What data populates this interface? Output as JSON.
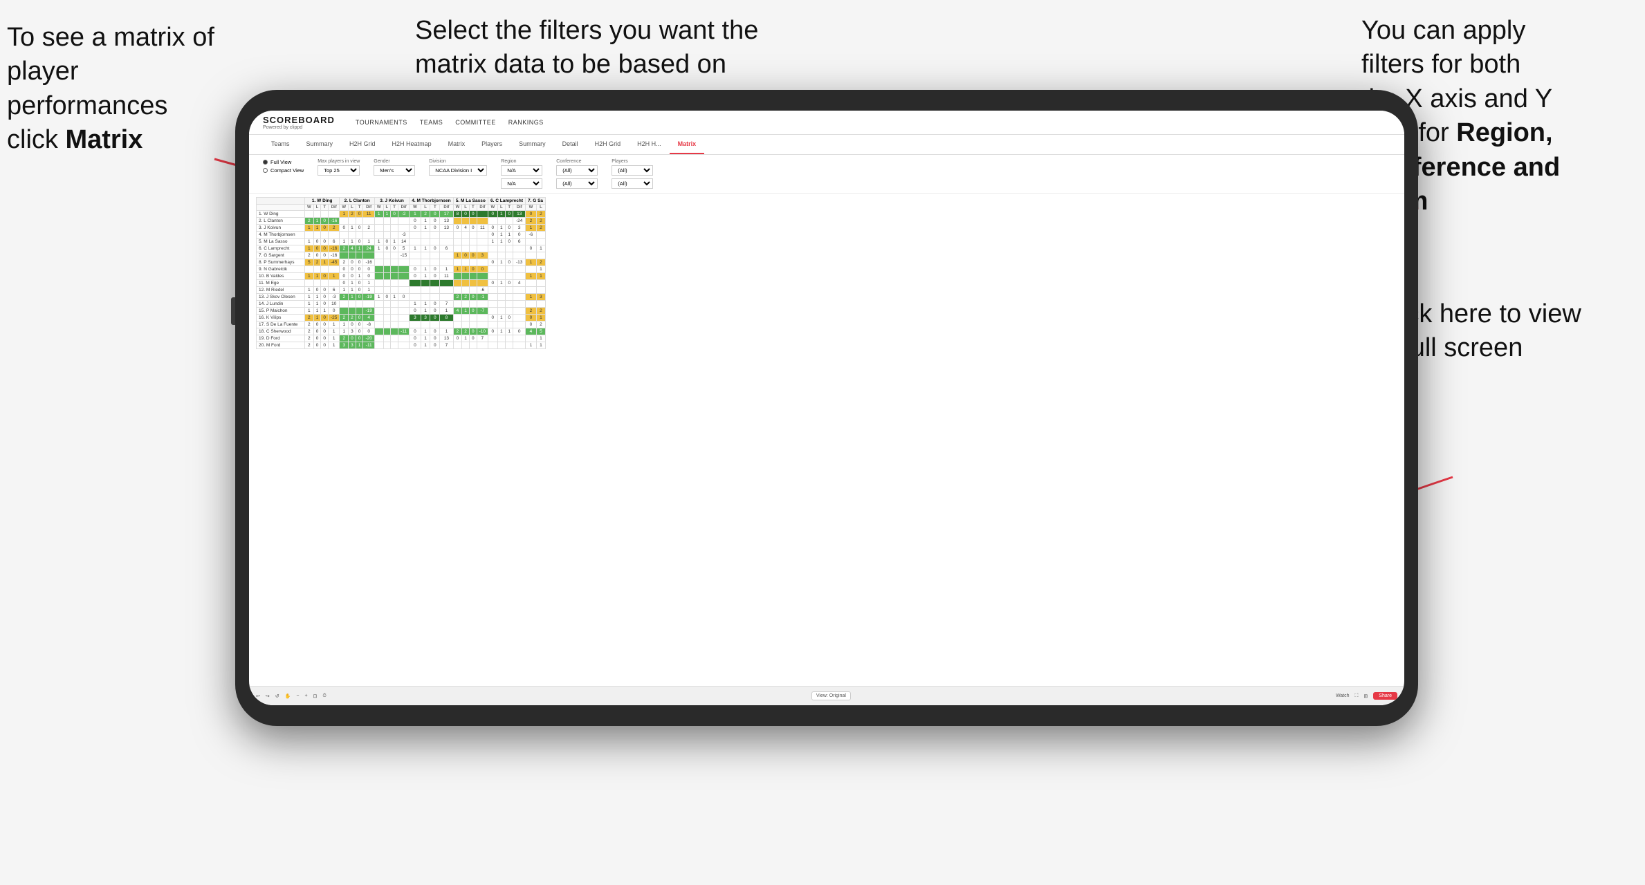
{
  "annotations": {
    "left": {
      "line1": "To see a matrix of",
      "line2": "player performances",
      "line3_plain": "click ",
      "line3_bold": "Matrix"
    },
    "center": {
      "line1": "Select the filters you want the",
      "line2": "matrix data to be based on"
    },
    "right_top": {
      "line1": "You  can apply",
      "line2": "filters for both",
      "line3": "the X axis and Y",
      "line4_plain": "Axis for ",
      "line4_bold": "Region,",
      "line5_bold": "Conference and",
      "line6_bold": "Team"
    },
    "right_bottom": {
      "line1": "Click here to view",
      "line2": "in full screen"
    }
  },
  "app": {
    "logo": "SCOREBOARD",
    "powered_by": "Powered by clippd",
    "nav_items": [
      "TOURNAMENTS",
      "TEAMS",
      "COMMITTEE",
      "RANKINGS"
    ],
    "sub_tabs": [
      "Teams",
      "Summary",
      "H2H Grid",
      "H2H Heatmap",
      "Matrix",
      "Players",
      "Summary",
      "Detail",
      "H2H Grid",
      "H2H H...",
      "Matrix"
    ],
    "active_tab": "Matrix",
    "filters": {
      "view_options": [
        "Full View",
        "Compact View"
      ],
      "selected_view": "Full View",
      "max_players_label": "Max players in view",
      "max_players_value": "Top 25",
      "gender_label": "Gender",
      "gender_value": "Men's",
      "division_label": "Division",
      "division_value": "NCAA Division I",
      "region_label": "Region",
      "region_value1": "N/A",
      "region_value2": "N/A",
      "conference_label": "Conference",
      "conference_value1": "(All)",
      "conference_value2": "(All)",
      "players_label": "Players",
      "players_value1": "(All)",
      "players_value2": "(All)"
    },
    "col_headers": [
      "1. W Ding",
      "2. L Clanton",
      "3. J Koivun",
      "4. M Thorbjornsen",
      "5. M La Sasso",
      "6. C Lamprecht",
      "7. G Sa"
    ],
    "sub_col_headers": [
      "W",
      "L",
      "T",
      "Dif"
    ],
    "row_players": [
      "1. W Ding",
      "2. L Clanton",
      "3. J Koivun",
      "4. M Thorbjornsen",
      "5. M La Sasso",
      "6. C Lamprecht",
      "7. G Sargent",
      "8. P Summerhays",
      "9. N Gabrelcik",
      "10. B Valdes",
      "11. M Ege",
      "12. M Riedel",
      "13. J Skov Olesen",
      "14. J Lundin",
      "15. P Maichon",
      "16. K Vilips",
      "17. S De La Fuente",
      "18. C Sherwood",
      "19. D Ford",
      "20. M Ford"
    ],
    "toolbar": {
      "view_label": "View: Original",
      "watch_label": "Watch",
      "share_label": "Share"
    }
  }
}
